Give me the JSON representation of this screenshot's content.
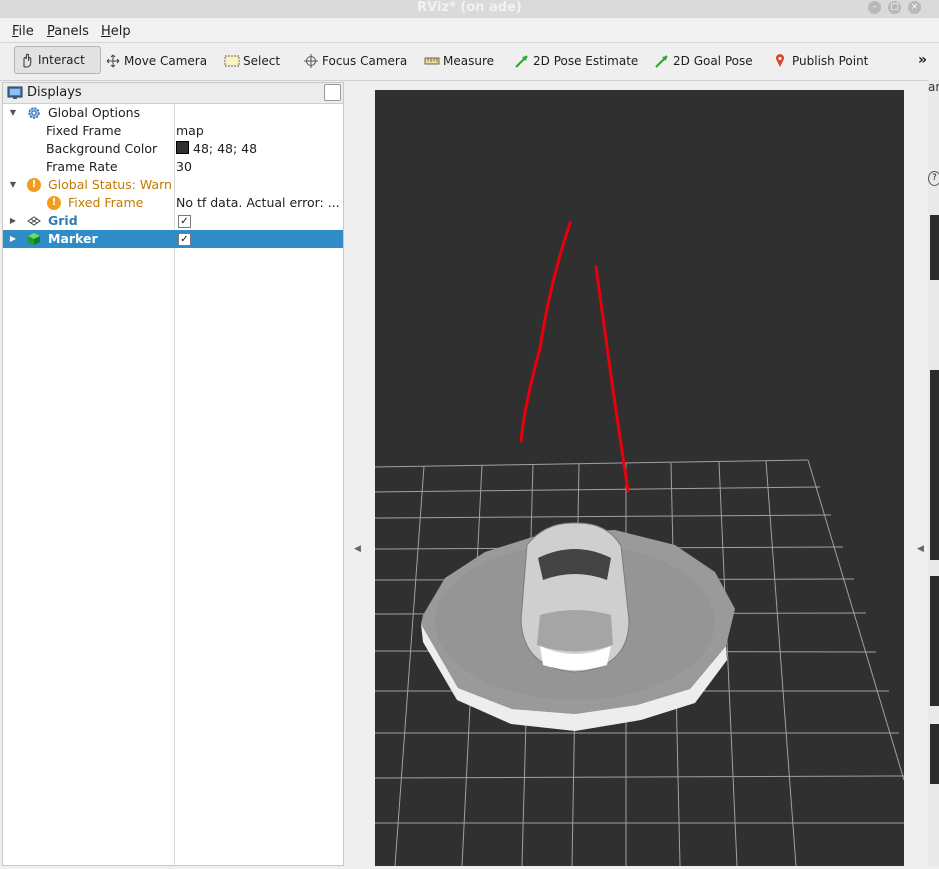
{
  "window": {
    "title": "RViz* (on ade)"
  },
  "menu": {
    "items": [
      {
        "mn": "F",
        "rest": "ile"
      },
      {
        "mn": "P",
        "rest": "anels"
      },
      {
        "mn": "H",
        "rest": "elp"
      }
    ]
  },
  "toolbar": {
    "tools": [
      {
        "label": "Interact",
        "icon": "hand-pointer-icon",
        "active": true
      },
      {
        "label": "Move Camera",
        "icon": "move-arrows-icon"
      },
      {
        "label": "Select",
        "icon": "select-rectangle-icon"
      },
      {
        "label": "Focus Camera",
        "icon": "crosshair-icon"
      },
      {
        "label": "Measure",
        "icon": "ruler-icon"
      },
      {
        "label": "2D Pose Estimate",
        "icon": "green-arrow-icon"
      },
      {
        "label": "2D Goal Pose",
        "icon": "green-arrow-icon"
      },
      {
        "label": "Publish Point",
        "icon": "map-pin-icon"
      }
    ],
    "overflow_label": "»"
  },
  "displays": {
    "title": "Displays",
    "rows": [
      {
        "label": "Global Options",
        "value": "",
        "icon": "gear-icon",
        "expanded": true
      },
      {
        "label": "Fixed Frame",
        "value": "map"
      },
      {
        "label": "Background Color",
        "value": "48; 48; 48",
        "swatch": "#303030"
      },
      {
        "label": "Frame Rate",
        "value": "30"
      },
      {
        "label": "Global Status: Warn",
        "value": "",
        "icon": "warning-icon",
        "expanded": true
      },
      {
        "label": "Fixed Frame",
        "value": "No tf data.  Actual error: ...",
        "icon": "warning-icon"
      },
      {
        "label": "Grid",
        "value": "",
        "icon": "grid-icon",
        "checked": true
      },
      {
        "label": "Marker",
        "value": "",
        "icon": "cube-icon",
        "checked": true,
        "selected": true
      }
    ]
  },
  "right_panel": {
    "partial_text": "ar"
  },
  "colors": {
    "accent": "#308cc6",
    "warn": "#c07a00",
    "bool_name": "#2c7bb6",
    "viewport_bg": "#303030",
    "marker": "#e8000b"
  }
}
